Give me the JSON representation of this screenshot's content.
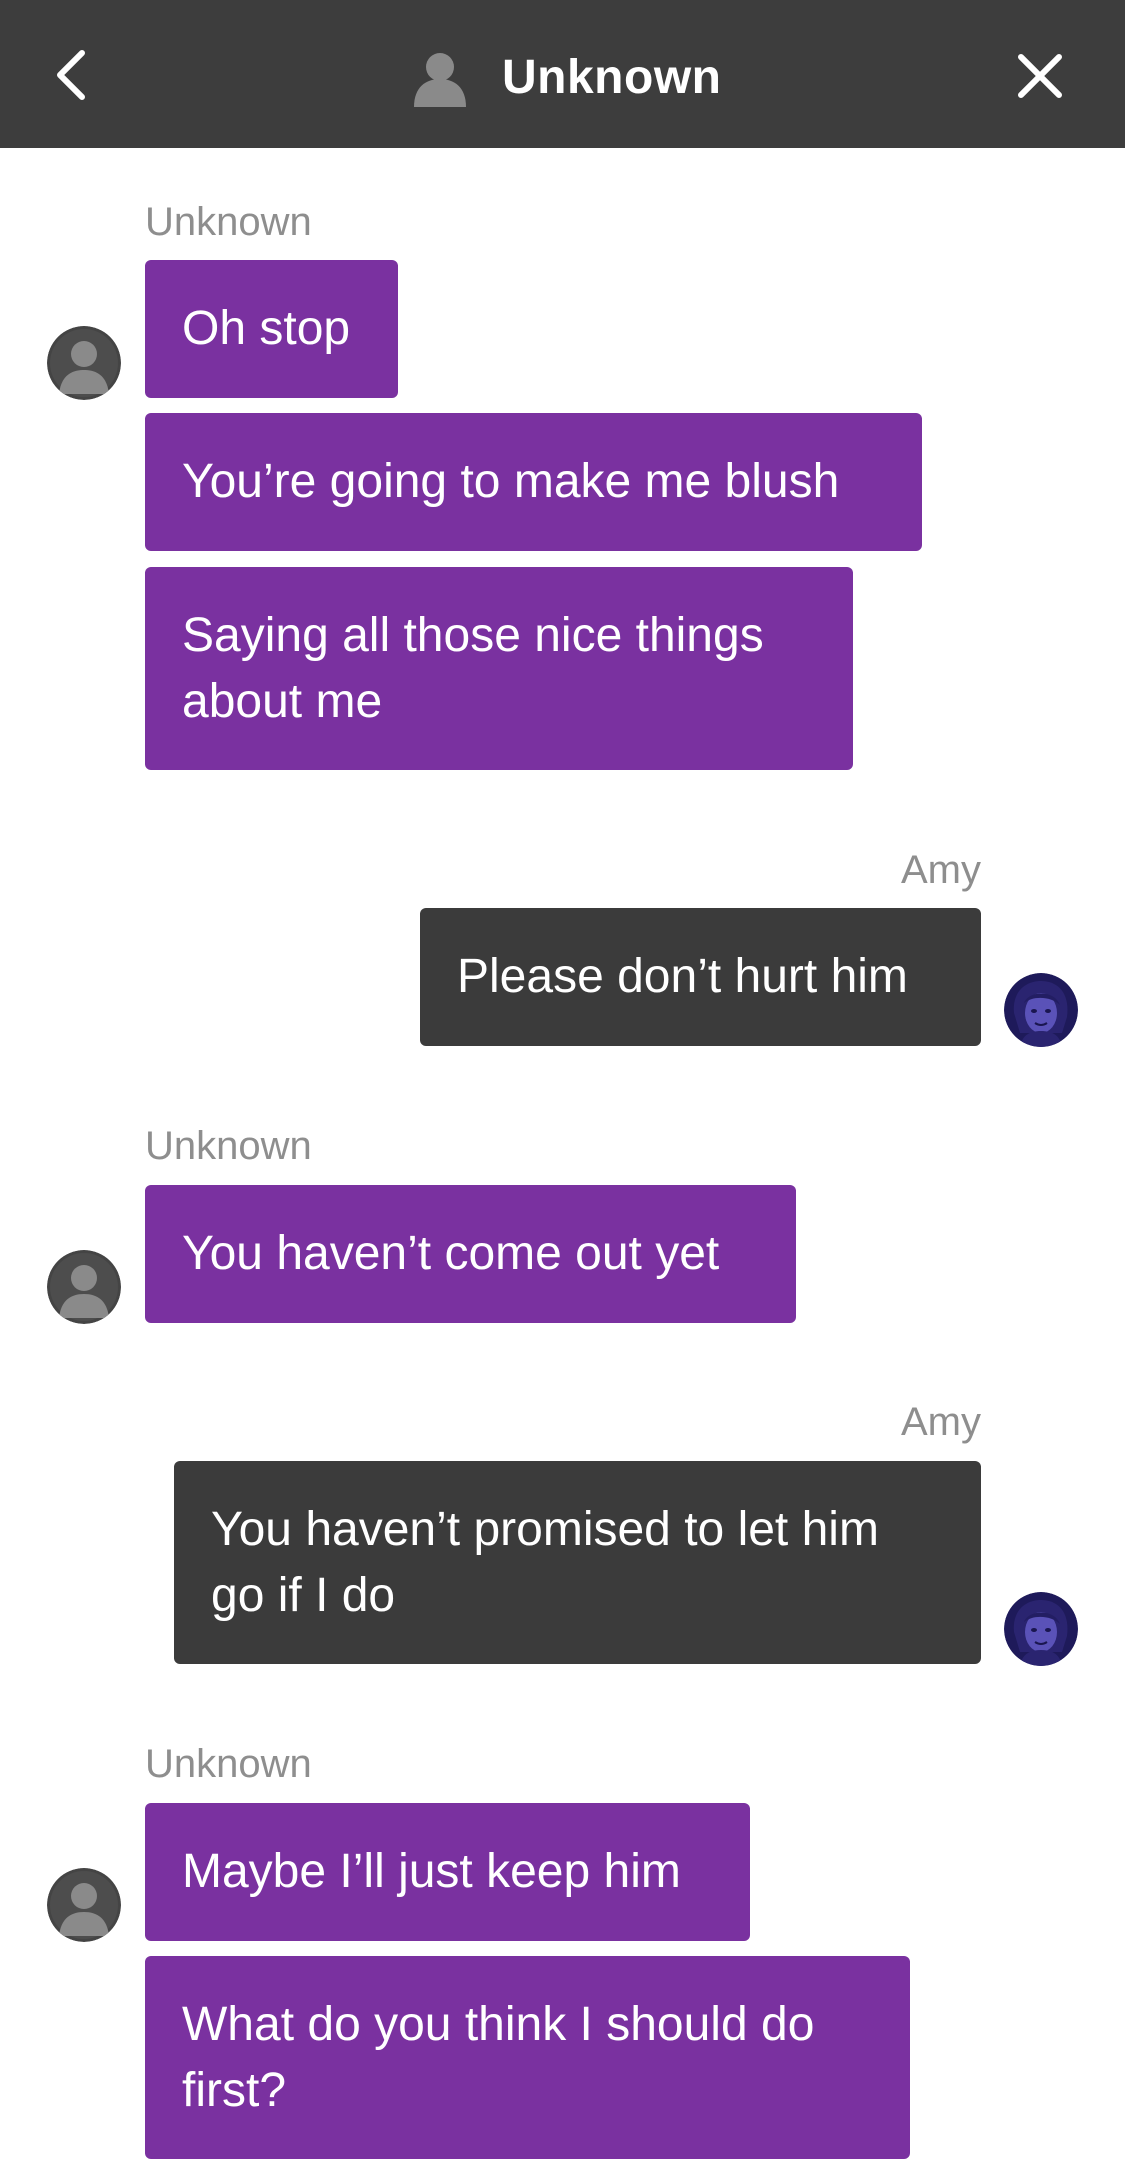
{
  "header": {
    "title": "Unknown",
    "back_icon": "chevron-left-icon",
    "close_icon": "close-icon",
    "avatar_icon": "person-silhouette-icon"
  },
  "colors": {
    "header_bg": "#3d3d3d",
    "them_bubble": "#7a31a0",
    "me_bubble": "#3b3b3b",
    "sender_label": "#8e8e8e"
  },
  "messages": [
    {
      "sender": "Unknown",
      "side": "left",
      "bubbles": [
        "Oh stop",
        "You’re going to make me blush",
        "Saying all those nice things about me"
      ]
    },
    {
      "sender": "Amy",
      "side": "right",
      "bubbles": [
        "Please don’t hurt him"
      ]
    },
    {
      "sender": "Unknown",
      "side": "left",
      "bubbles": [
        "You haven’t come out yet"
      ]
    },
    {
      "sender": "Amy",
      "side": "right",
      "bubbles": [
        "You haven’t promised to let him go if I do"
      ]
    },
    {
      "sender": "Unknown",
      "side": "left",
      "bubbles": [
        "Maybe I’ll just keep him",
        "What do you think I should do first?"
      ]
    }
  ]
}
